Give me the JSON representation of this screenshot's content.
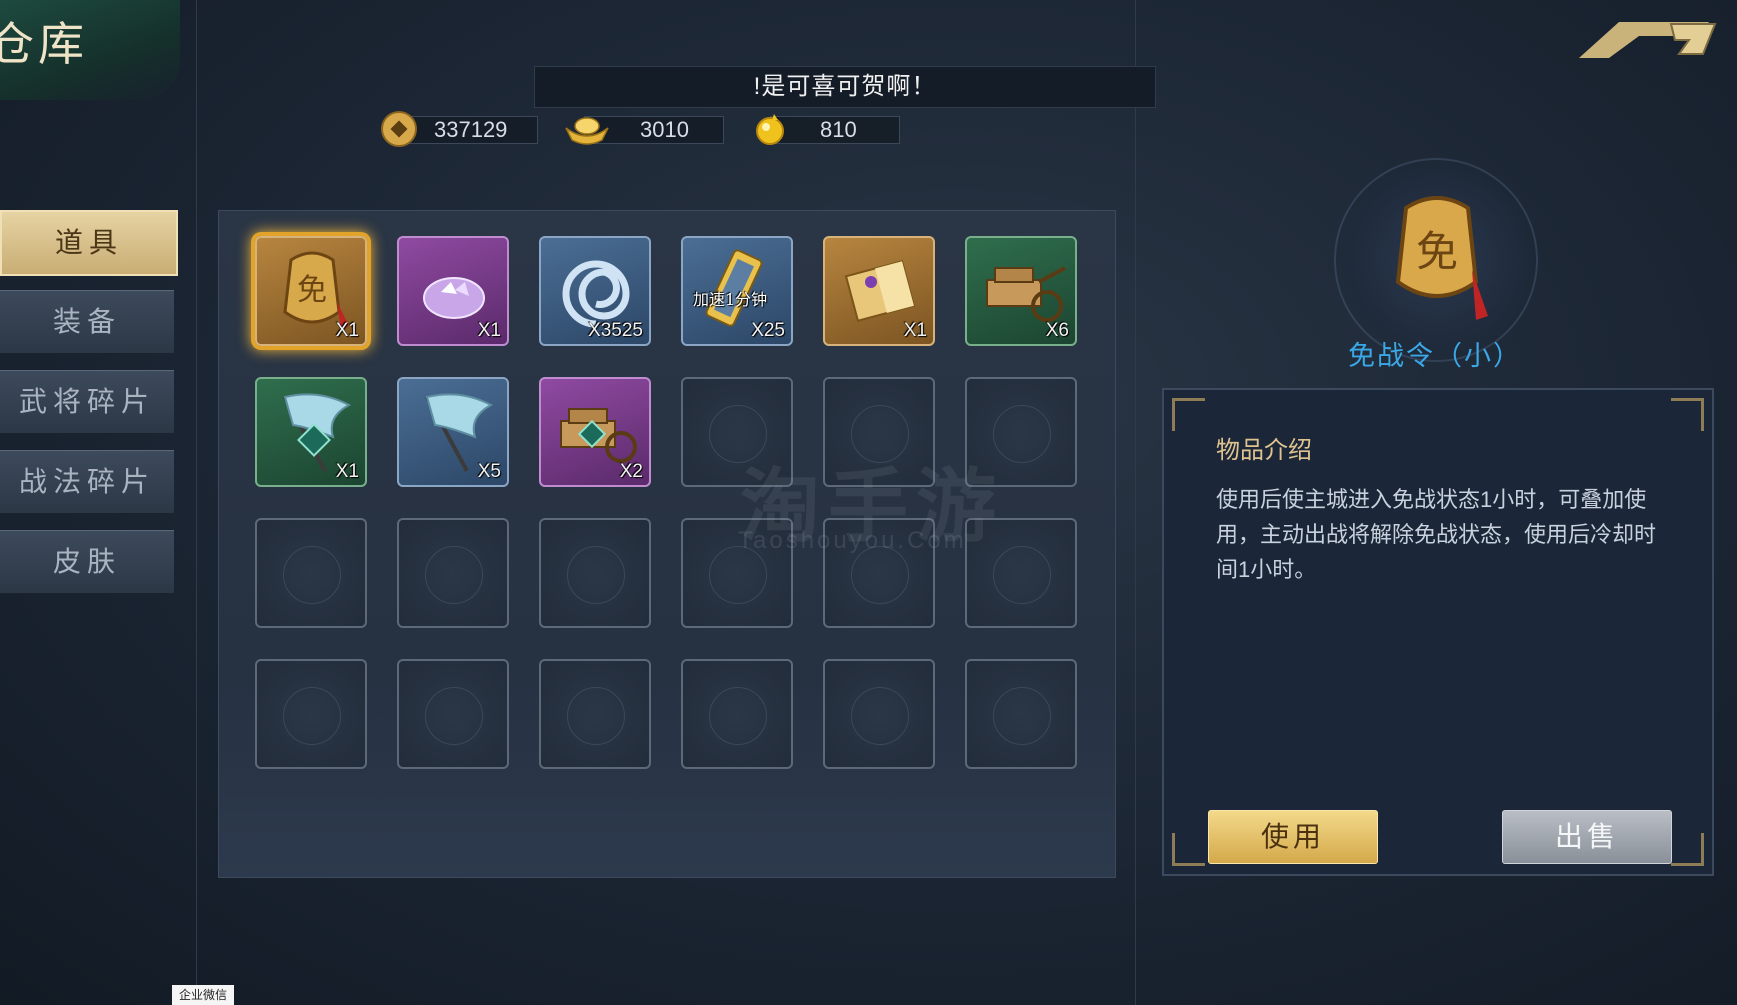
{
  "header": {
    "title": "仓库",
    "toast": "!是可喜可贺啊！"
  },
  "currencies": [
    {
      "name": "copper-coin",
      "value": "337129"
    },
    {
      "name": "gold-ingot",
      "value": "3010"
    },
    {
      "name": "gold-orb",
      "value": "810"
    }
  ],
  "tabs": [
    {
      "label": "道具",
      "active": true
    },
    {
      "label": "装备"
    },
    {
      "label": "武将碎片"
    },
    {
      "label": "战法碎片"
    },
    {
      "label": "皮肤"
    }
  ],
  "inventory": {
    "items": [
      {
        "icon": "truce-token-icon",
        "count": "X1",
        "quality": "gold",
        "selected": true
      },
      {
        "icon": "crystal-bowl-icon",
        "count": "X1",
        "quality": "purple"
      },
      {
        "icon": "spiral-jade-icon",
        "count": "X3525",
        "quality": "blue"
      },
      {
        "icon": "speedup-scroll-icon",
        "count": "X25",
        "quality": "blue",
        "label": "加速1分钟"
      },
      {
        "icon": "gold-book-icon",
        "count": "X1",
        "quality": "gold"
      },
      {
        "icon": "supply-cart-icon",
        "count": "X6",
        "quality": "green"
      },
      {
        "icon": "new-banner-icon",
        "count": "X1",
        "quality": "green"
      },
      {
        "icon": "banner-icon",
        "count": "X5",
        "quality": "blue"
      },
      {
        "icon": "new-supply-cart-icon",
        "count": "X2",
        "quality": "purple"
      }
    ]
  },
  "watermark": {
    "main": "淘手游",
    "sub": "Taoshouyou.Com"
  },
  "detail": {
    "name": "免战令（小）",
    "section_title": "物品介绍",
    "description": "使用后使主城进入免战状态1小时，可叠加使用，主动出战将解除免战状态，使用后冷却时间1小时。",
    "use_label": "使用",
    "sell_label": "出售"
  },
  "footer": {
    "taskbar_label": "企业微信"
  },
  "colors": {
    "accent_gold": "#e2a32a",
    "item_name": "#3aa7e6",
    "panel_bg": "#263142"
  }
}
